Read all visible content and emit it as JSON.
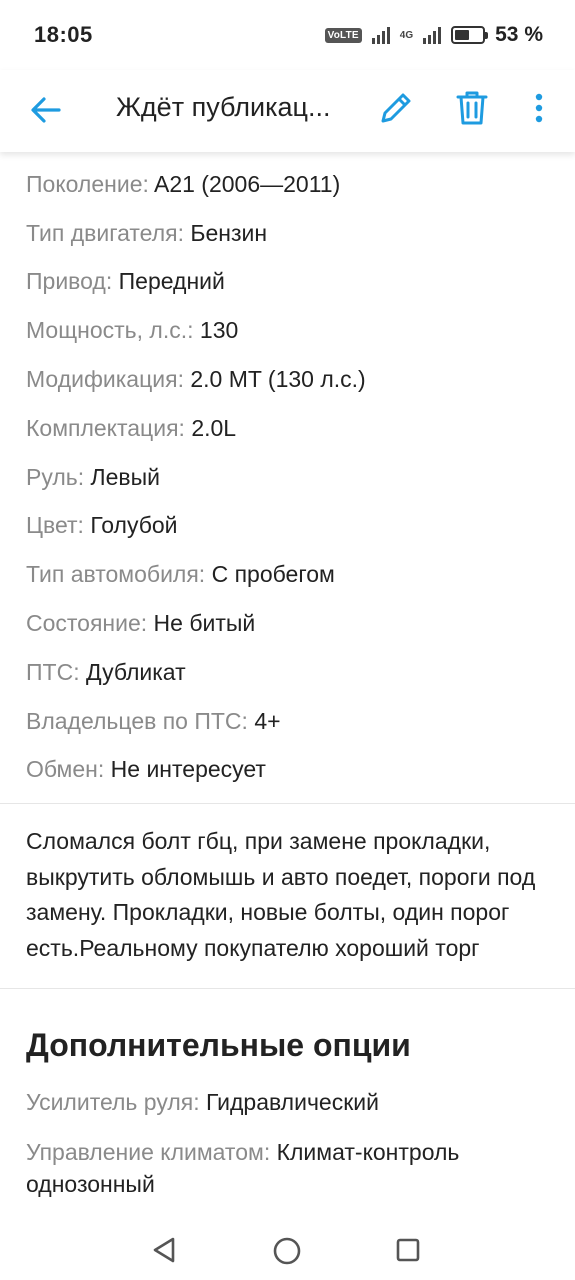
{
  "status_bar": {
    "time": "18:05",
    "volte": "VoLTE",
    "sim": "1 2",
    "network": "4G",
    "battery_percent": "53 %",
    "battery_level": 0.53
  },
  "app_bar": {
    "title": "Ждёт публикац...",
    "icons": {
      "back": "arrow-left-icon",
      "edit": "pencil-icon",
      "delete": "trash-icon",
      "more": "more-vertical-icon"
    },
    "accent_color": "#1e9be0"
  },
  "specs": [
    {
      "label": "Поколение:",
      "value": " A21 (2006—2011)"
    },
    {
      "label": "Тип двигателя:",
      "value": " Бензин"
    },
    {
      "label": "Привод:",
      "value": " Передний"
    },
    {
      "label": "Мощность, л.с.:",
      "value": " 130"
    },
    {
      "label": "Модификация:",
      "value": " 2.0 MT (130 л.с.)"
    },
    {
      "label": "Комплектация:",
      "value": " 2.0L"
    },
    {
      "label": "Руль:",
      "value": " Левый"
    },
    {
      "label": "Цвет:",
      "value": " Голубой"
    },
    {
      "label": "Тип автомобиля:",
      "value": " С пробегом"
    },
    {
      "label": "Состояние:",
      "value": " Не битый"
    },
    {
      "label": "ПТС:",
      "value": " Дубликат"
    },
    {
      "label": "Владельцев по ПТС:",
      "value": " 4+"
    },
    {
      "label": "Обмен:",
      "value": " Не интересует"
    }
  ],
  "description": "Сломался болт гбц, при замене прокладки, выкрутить обломышь и авто поедет, пороги под замену. Прокладки, новые болты, один порог есть.Реальному покупателю хороший торг",
  "extra_options": {
    "title": "Дополнительные опции",
    "items": [
      {
        "label": "Усилитель руля:",
        "value": " Гидравлический"
      },
      {
        "label": "Управление климатом:",
        "value": " Климат-контроль однозонный"
      }
    ]
  },
  "nav_bar": {
    "icons": [
      "back-triangle-icon",
      "home-circle-icon",
      "recents-square-icon"
    ]
  }
}
